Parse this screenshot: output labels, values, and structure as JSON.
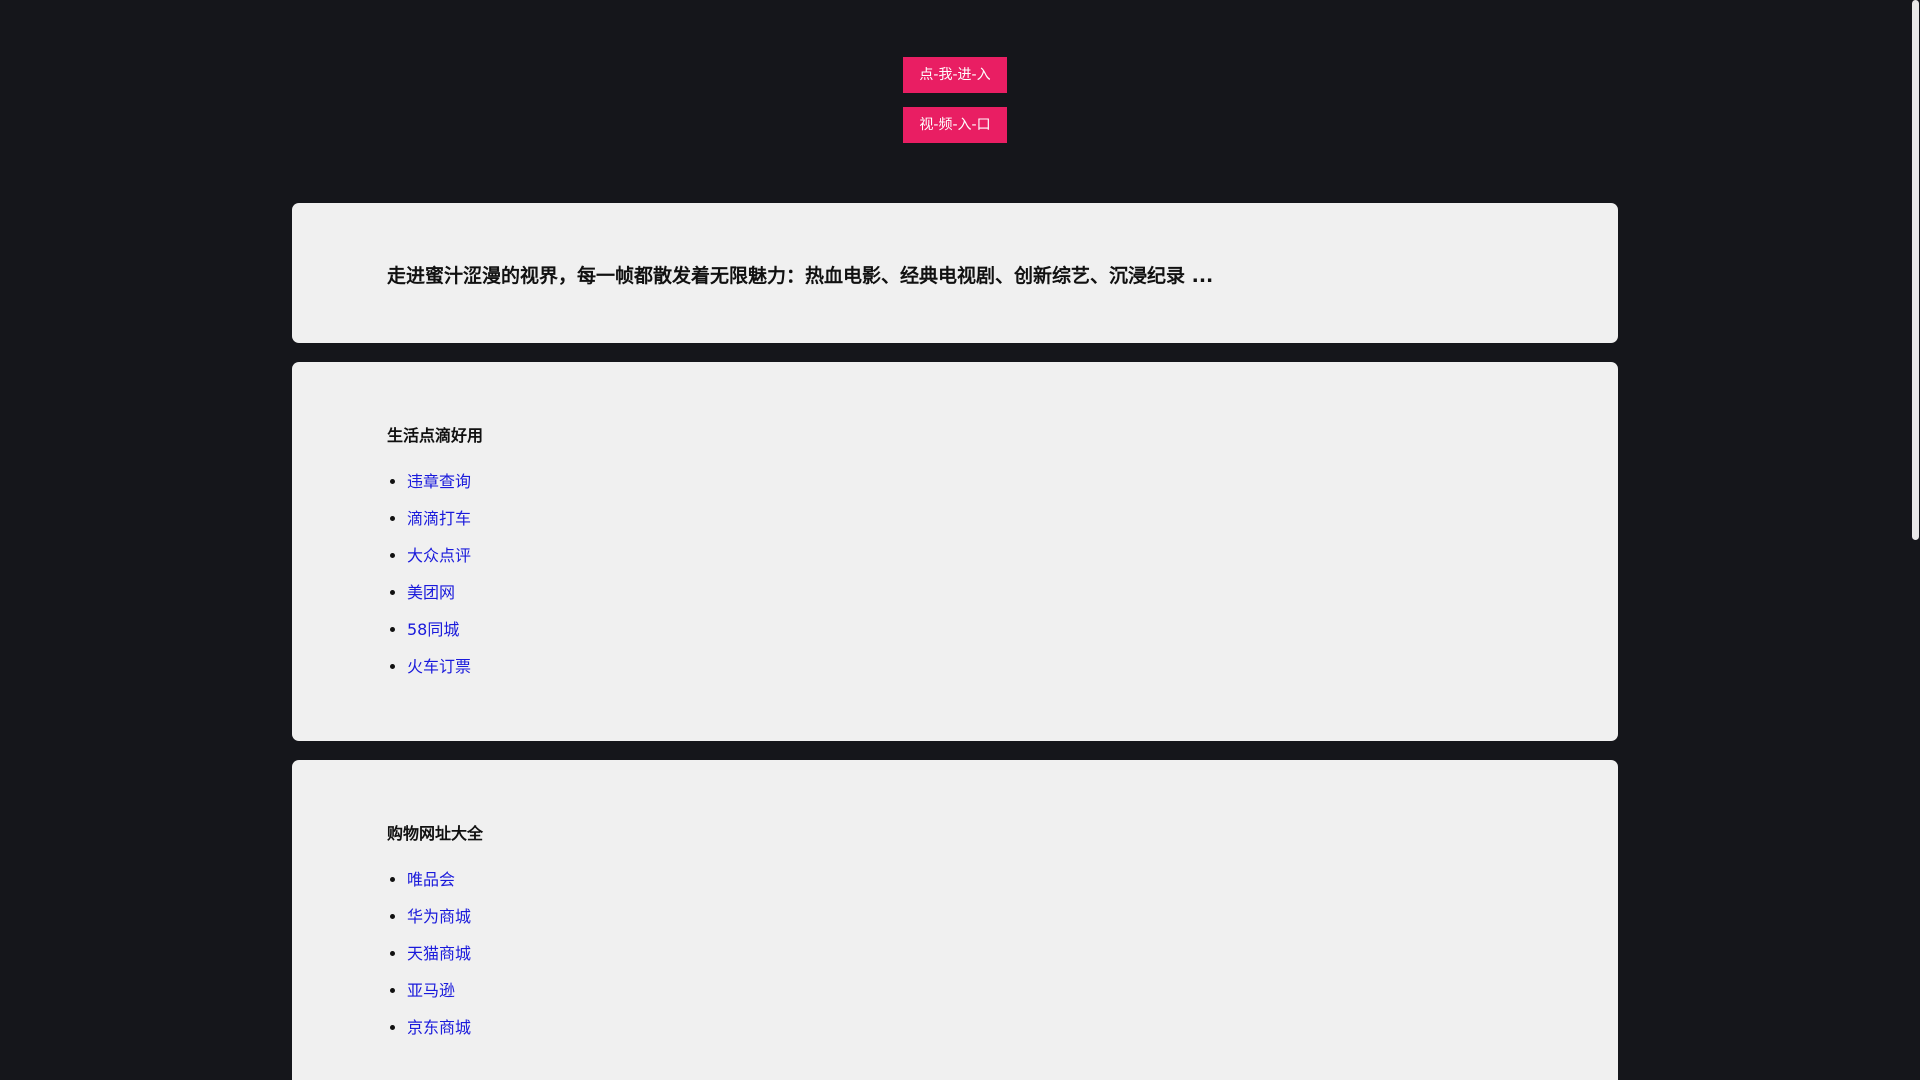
{
  "buttons": {
    "enter": "点-我-进-入",
    "video": "视-频-入-口"
  },
  "intro": {
    "text": "走进蜜汁涩漫的视界，每一帧都散发着无限魅力：热血电影、经典电视剧、创新综艺、沉浸纪录 ..."
  },
  "life": {
    "title": "生活点滴好用",
    "links": [
      "违章查询",
      "滴滴打车",
      "大众点评",
      "美团网",
      "58同城",
      "火车订票"
    ]
  },
  "shopping": {
    "title": "购物网址大全",
    "links": [
      "唯品会",
      "华为商城",
      "天猫商城",
      "亚马逊",
      "京东商城"
    ]
  },
  "colors": {
    "background": "#15161b",
    "button": "#e91e63",
    "card": "#f0f0f0",
    "link": "#1a1adb"
  }
}
